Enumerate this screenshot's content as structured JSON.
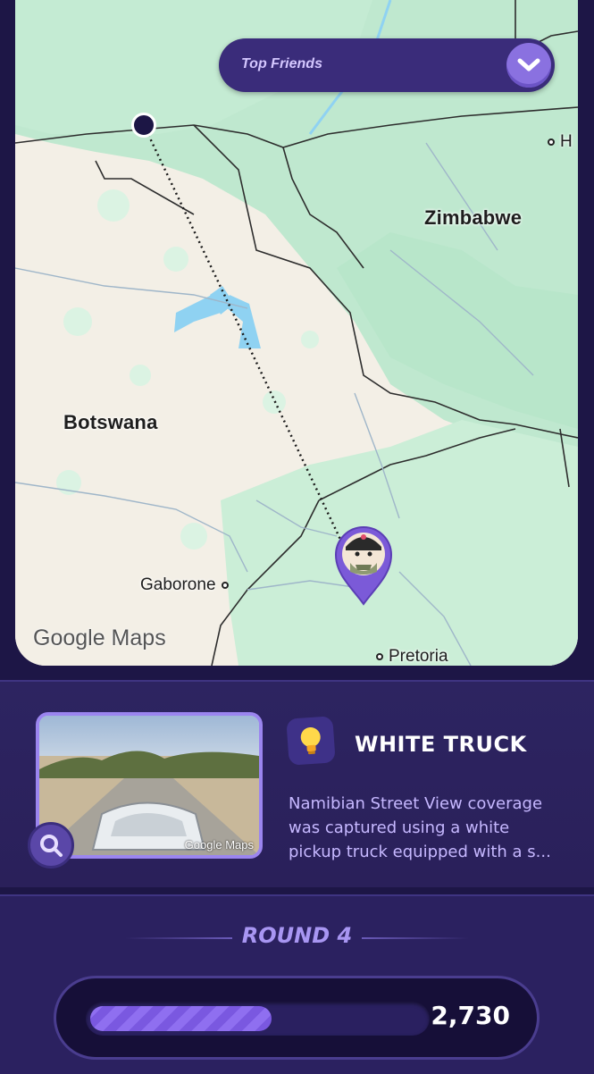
{
  "map": {
    "top_friends_label": "Top Friends",
    "labels": {
      "zimbabwe": "Zimbabwe",
      "botswana": "Botswana",
      "gaborone": "Gaborone",
      "pretoria": "Pretoria",
      "h_city": "H"
    },
    "attribution": "Google Maps"
  },
  "hint": {
    "title": "WHITE TRUCK",
    "text": "Namibian Street View coverage was captured using a white pickup truck equipped with a s...",
    "street_view_attribution": "Google Maps"
  },
  "round": {
    "label": "ROUND 4",
    "score": "2,730",
    "progress_fraction": 0.54
  },
  "colors": {
    "accent": "#8a71e0",
    "background": "#1d1646",
    "panel": "#2d2461"
  }
}
